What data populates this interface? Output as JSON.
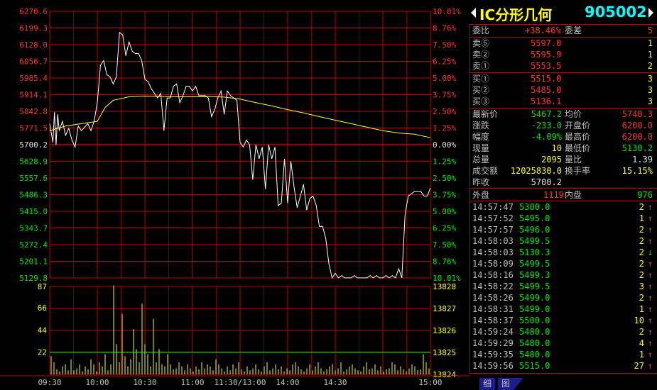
{
  "header": {
    "name": "IC分形几何",
    "code": "905002"
  },
  "commission": {
    "ratio_label": "委比",
    "ratio_value": "+38.46%",
    "diff_label": "委差",
    "diff_value": "5"
  },
  "asks": [
    {
      "label": "卖⑤",
      "price": "5597.0",
      "volume": "1"
    },
    {
      "label": "卖②",
      "price": "5595.9",
      "volume": "1"
    },
    {
      "label": "卖①",
      "price": "5553.5",
      "volume": "2"
    }
  ],
  "bids": [
    {
      "label": "买①",
      "price": "5515.0",
      "volume": "3"
    },
    {
      "label": "买②",
      "price": "5485.0",
      "volume": "3"
    },
    {
      "label": "买③",
      "price": "5136.1",
      "volume": "3"
    }
  ],
  "quote": [
    {
      "l1": "最新价",
      "v1": "5467.2",
      "l2": "均价",
      "v2": "5740.3"
    },
    {
      "l1": "涨跌",
      "v1": "-233.0",
      "l2": "开盘价",
      "v2": "6200.0"
    },
    {
      "l1": "幅度",
      "v1": "-4.09%",
      "l2": "最高价",
      "v2": "6200.0"
    },
    {
      "l1": "现量",
      "v1": "10",
      "l2": "最低价",
      "v2": "5130.2"
    },
    {
      "l1": "总量",
      "v1": "2095",
      "l2": "量比",
      "v2": "1.39"
    },
    {
      "l1": "成交额",
      "v1": "12025830.0",
      "l2": "换手率",
      "v2": "15.15%"
    },
    {
      "l1": "昨收",
      "v1": "5700.2",
      "l2": "",
      "v2": ""
    }
  ],
  "outer_inner": {
    "outer_label": "外盘",
    "outer_value": "1119",
    "inner_label": "内盘",
    "inner_value": "976"
  },
  "ticks": [
    {
      "time": "14:57:47",
      "price": "5300.0",
      "vol": "2",
      "dir": "↑"
    },
    {
      "time": "14:57:52",
      "price": "5495.0",
      "vol": "1",
      "dir": "↑"
    },
    {
      "time": "14:57:57",
      "price": "5496.0",
      "vol": "2",
      "dir": "↑"
    },
    {
      "time": "14:58:03",
      "price": "5499.5",
      "vol": "2",
      "dir": "↑"
    },
    {
      "time": "14:58:03",
      "price": "5130.3",
      "vol": "2",
      "dir": "↓"
    },
    {
      "time": "14:58:09",
      "price": "5499.5",
      "vol": "2",
      "dir": "↑"
    },
    {
      "time": "14:58:16",
      "price": "5499.3",
      "vol": "2",
      "dir": "↑"
    },
    {
      "time": "14:58:22",
      "price": "5499.5",
      "vol": "3",
      "dir": "↑"
    },
    {
      "time": "14:58:26",
      "price": "5499.0",
      "vol": "2",
      "dir": "↑"
    },
    {
      "time": "14:58:31",
      "price": "5499.0",
      "vol": "1",
      "dir": "↑"
    },
    {
      "time": "14:58:37",
      "price": "5500.0",
      "vol": "10",
      "dir": "↑"
    },
    {
      "time": "14:59:24",
      "price": "5480.0",
      "vol": "2",
      "dir": "↑"
    },
    {
      "time": "14:59:29",
      "price": "5480.0",
      "vol": "4",
      "dir": "↑"
    },
    {
      "time": "14:59:35",
      "price": "5480.0",
      "vol": "1",
      "dir": "↑"
    },
    {
      "time": "14:59:56",
      "price": "5515.0",
      "vol": "27",
      "dir": "↑"
    }
  ],
  "tabs": [
    "细",
    "图"
  ],
  "colors": {
    "grid": "#c00000",
    "price_line": "#ffffff",
    "avg_line": "#ffff00",
    "volume_bar": "#ffff00",
    "vol_ma": "#00ff00",
    "up": "#ff3232",
    "down": "#00e600",
    "title": "#ffff00",
    "code": "#00ffff"
  },
  "chart_data": {
    "type": "line",
    "price_axis_left": [
      "6270.6",
      "6199.3",
      "6128.0",
      "6056.7",
      "5985.4",
      "5914.1",
      "5842.8",
      "5771.5",
      "5700.2",
      "5628.9",
      "5557.6",
      "5486.3",
      "5415.0",
      "5343.7",
      "5272.4",
      "5201.1",
      "5129.8"
    ],
    "pct_axis_right": [
      "10.01%",
      "8.76%",
      "7.50%",
      "6.25%",
      "5.00%",
      "3.75%",
      "2.50%",
      "1.25%",
      "0.00%",
      "1.25%",
      "2.50%",
      "3.75%",
      "5.00%",
      "6.25%",
      "7.50%",
      "8.76%",
      "10.01%"
    ],
    "volume_axis_left": [
      "87",
      "66",
      "44",
      "22"
    ],
    "volume_axis_right": [
      "13828",
      "13827",
      "13826",
      "13825",
      "13824"
    ],
    "time_labels": [
      "09:30",
      "10:00",
      "10:30",
      "11:00",
      "11:30/13:00",
      "14:00",
      "14:30",
      "15:00"
    ],
    "ylim": [
      5129.8,
      6270.6
    ],
    "prev_close": 5700.2,
    "price_series": {
      "x_minutes": [
        0,
        2,
        3,
        4,
        5,
        6,
        8,
        10,
        12,
        14,
        16,
        18,
        20,
        22,
        24,
        26,
        28,
        30,
        32,
        34,
        36,
        38,
        40,
        42,
        44,
        46,
        48,
        50,
        52,
        54,
        56,
        58,
        60,
        62,
        64,
        66,
        68,
        70,
        72,
        74,
        76,
        78,
        80,
        82,
        84,
        86,
        88,
        90,
        92,
        94,
        96,
        98,
        100,
        102,
        104,
        106,
        108,
        110,
        112,
        114,
        116,
        118,
        120,
        122,
        124,
        126,
        128,
        130,
        132,
        134,
        136,
        138,
        140,
        142,
        144,
        146,
        148,
        150,
        152,
        154,
        156,
        158,
        160,
        162,
        164,
        166,
        168,
        170,
        172,
        174,
        176,
        178,
        180,
        182,
        184,
        186,
        188,
        190,
        192,
        194,
        196,
        198,
        200,
        202,
        204,
        206,
        208,
        210,
        212,
        214,
        216,
        218,
        220,
        222,
        224,
        226,
        228,
        230,
        232,
        234,
        236,
        238,
        240
      ],
      "values": [
        5790,
        5710,
        5840,
        5700,
        5830,
        5760,
        5800,
        5740,
        5770,
        5720,
        5690,
        5780,
        5760,
        5775,
        5790,
        5760,
        5800,
        5880,
        6040,
        6060,
        6000,
        5990,
        5960,
        5990,
        6180,
        6170,
        6080,
        6140,
        6100,
        6090,
        6090,
        6060,
        5980,
        5970,
        5940,
        5920,
        5900,
        5920,
        5760,
        5900,
        5900,
        5950,
        5960,
        5880,
        5910,
        5950,
        5950,
        5930,
        5950,
        5910,
        5910,
        5910,
        5900,
        5820,
        5850,
        5900,
        5930,
        5830,
        5930,
        5910,
        5900,
        5890,
        5710,
        5690,
        5720,
        5700,
        5550,
        5700,
        5640,
        5690,
        5510,
        5700,
        5640,
        5690,
        5440,
        5450,
        5640,
        5450,
        5630,
        5520,
        5430,
        5480,
        5530,
        5420,
        5470,
        5480,
        5440,
        5350,
        5350,
        5300,
        5190,
        5130,
        5150,
        5130,
        5140,
        5130,
        5130,
        5130,
        5140,
        5130,
        5130,
        5130,
        5130,
        5140,
        5130,
        5140,
        5130,
        5130,
        5140,
        5130,
        5140,
        5130,
        5170,
        5130,
        5400,
        5480,
        5490,
        5500,
        5500,
        5500,
        5480,
        5480,
        5515
      ],
      "name": ""
    },
    "avg_series": {
      "x_minutes": [
        0,
        10,
        20,
        30,
        35,
        40,
        50,
        60,
        70,
        80,
        90,
        100,
        110,
        120,
        130,
        140,
        150,
        160,
        170,
        180,
        190,
        200,
        210,
        220,
        230,
        240
      ],
      "values": [
        5760,
        5780,
        5790,
        5800,
        5860,
        5890,
        5905,
        5908,
        5906,
        5905,
        5905,
        5906,
        5904,
        5895,
        5880,
        5866,
        5850,
        5836,
        5820,
        5805,
        5790,
        5775,
        5760,
        5750,
        5745,
        5730
      ]
    },
    "volume_series": {
      "values": [
        18,
        12,
        5,
        3,
        8,
        10,
        4,
        15,
        4,
        6,
        10,
        3,
        8,
        5,
        15,
        10,
        3,
        12,
        8,
        20,
        4,
        10,
        88,
        30,
        12,
        60,
        18,
        8,
        15,
        45,
        25,
        12,
        70,
        30,
        20,
        8,
        55,
        12,
        25,
        10,
        8,
        20,
        10,
        5,
        6,
        12,
        8,
        4,
        10,
        6,
        3,
        8,
        5,
        12,
        6,
        10,
        8,
        4,
        15,
        10,
        6,
        3,
        8,
        4,
        10,
        6,
        12,
        5,
        3,
        8,
        4,
        6,
        10,
        5,
        3,
        8,
        12,
        4,
        6,
        10,
        5,
        8,
        3,
        6,
        4,
        10,
        12,
        8,
        5,
        3,
        6,
        10,
        4,
        8,
        12,
        6,
        3,
        5,
        8,
        10,
        4,
        6,
        12,
        3,
        5,
        8,
        10,
        6,
        4,
        3,
        8,
        12,
        5,
        6,
        10,
        4,
        8,
        3,
        5,
        6,
        12,
        10,
        4,
        8,
        5,
        3,
        6,
        10,
        8,
        4,
        5,
        20,
        12,
        6
      ],
      "ma_level": 22
    }
  }
}
